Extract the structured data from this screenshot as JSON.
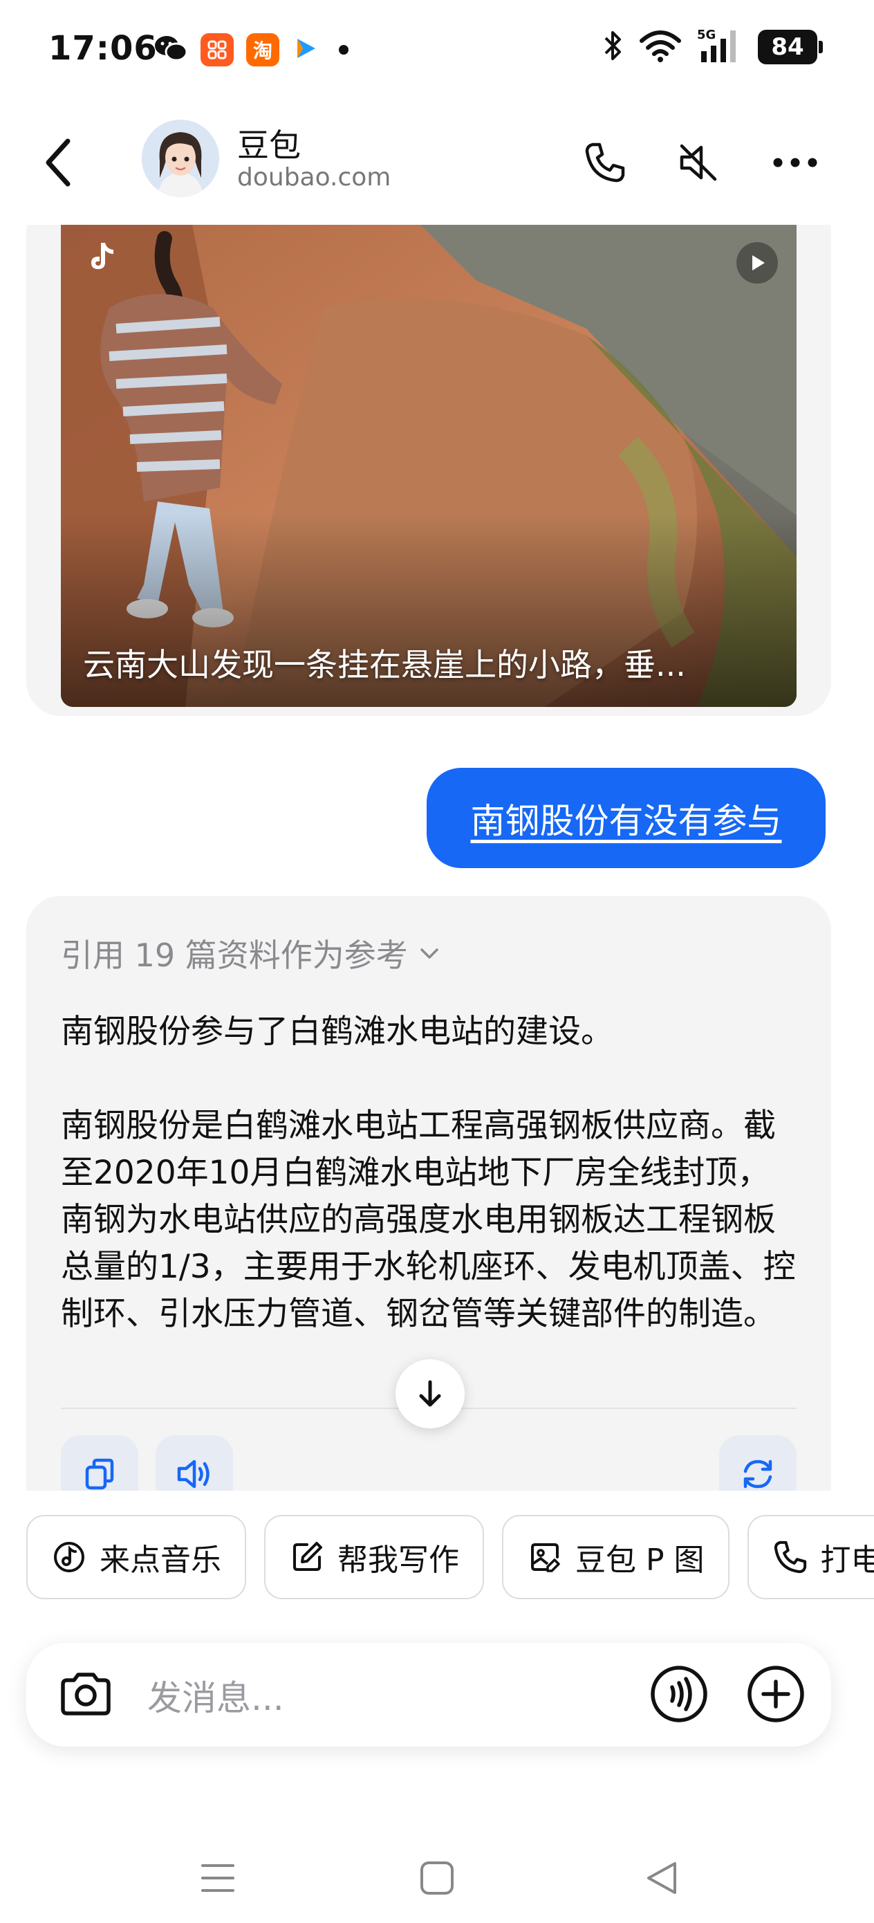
{
  "status_bar": {
    "time": "17:06",
    "battery": "84",
    "network": "5G",
    "app_icons": [
      "wechat-icon",
      "xiaohongshu-icon",
      "taobao-icon",
      "play-icon"
    ]
  },
  "header": {
    "name": "豆包",
    "subtitle": "doubao.com"
  },
  "video_card": {
    "caption": "云南大山发现一条挂在悬崖上的小路，垂..."
  },
  "user_message": "南钢股份有没有参与",
  "answer": {
    "references_label": "引用 19 篇资料作为参考",
    "paragraph1": "南钢股份参与了白鹤滩水电站的建设。",
    "paragraph2": "南钢股份是白鹤滩水电站工程高强钢板供应商。截至2020年10月白鹤滩水电站地下厂房全线封顶，南钢为水电站供应的高强度水电用钢板达工程钢板总量的1/3，主要用于水轮机座环、发电机顶盖、控制环、引水压力管道、钢岔管等关键部件的制造。"
  },
  "chips": [
    {
      "label": "来点音乐",
      "icon": "music-icon"
    },
    {
      "label": "帮我写作",
      "icon": "edit-icon"
    },
    {
      "label": "豆包 P 图",
      "icon": "image-edit-icon"
    },
    {
      "label": "打电",
      "icon": "phone-icon"
    }
  ],
  "input": {
    "placeholder": "发消息..."
  },
  "colors": {
    "accent": "#1668f5",
    "bubble_bg": "#f4f4f5"
  }
}
